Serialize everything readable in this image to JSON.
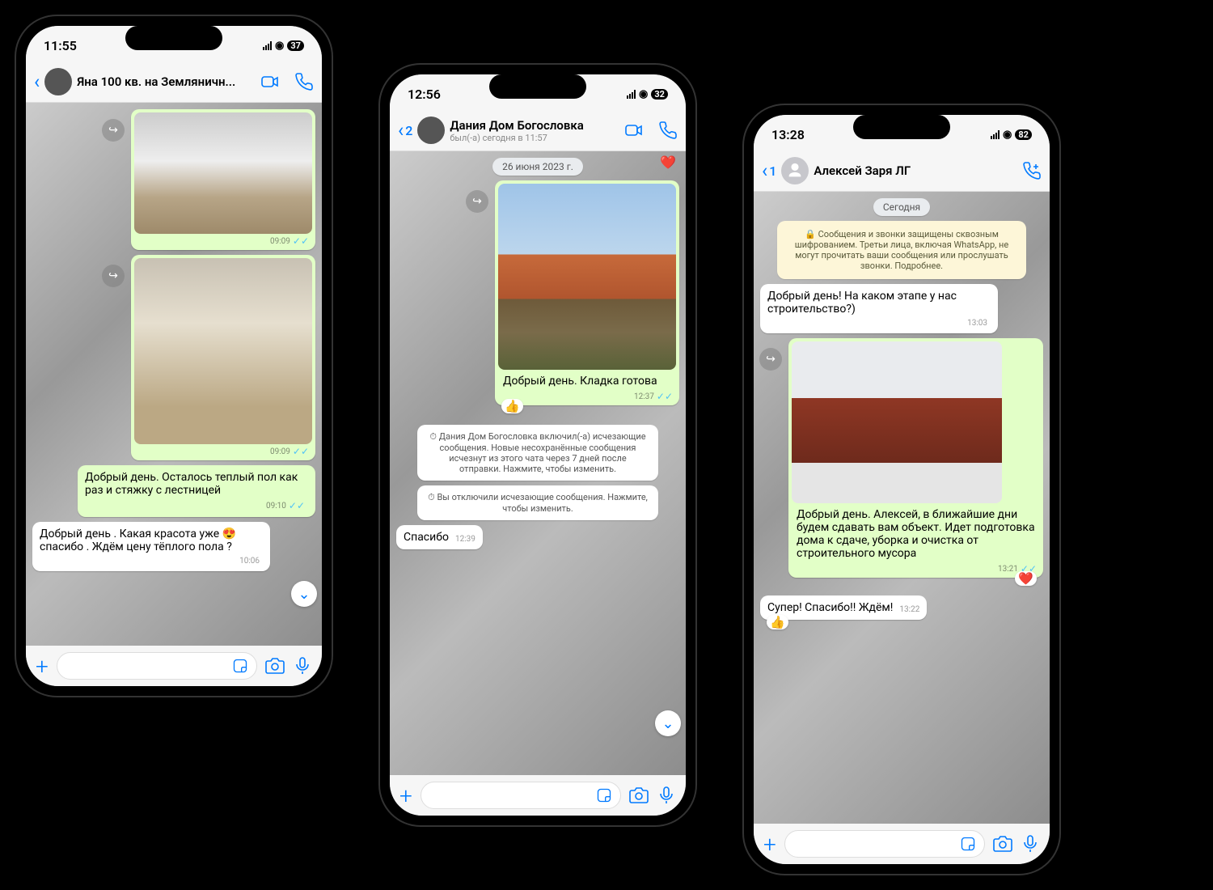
{
  "phone1": {
    "status_time": "11:55",
    "battery": "37",
    "contact": "Яна 100 кв. на Земляничн...",
    "img1_time": "09:09",
    "img2_time": "09:09",
    "out_msg": "Добрый день. Осталось теплый пол как раз и стяжку с лестницей",
    "out_time": "09:10",
    "in_msg": "Добрый день . Какая красота уже 😍 спасибо . Ждём цену тёплого пола ?",
    "in_time": "10:06"
  },
  "phone2": {
    "status_time": "12:56",
    "battery": "32",
    "back_count": "2",
    "contact": "Дания Дом Богословка",
    "contact_sub": "был(-а) сегодня в 11:57",
    "day": "26 июня 2023 г.",
    "out_msg": "Добрый день. Кладка готова",
    "out_time": "12:37",
    "reaction": "👍",
    "sys1": "⏱ Дания Дом Богословка включил(-а) исчезающие сообщения. Новые несохранённые сообщения исчезнут из этого чата через 7 дней после отправки. Нажмите, чтобы изменить.",
    "sys2": "⏱ Вы отключили исчезающие сообщения. Нажмите, чтобы изменить.",
    "in_msg": "Спасибо",
    "in_time": "12:39"
  },
  "phone3": {
    "status_time": "13:28",
    "battery": "82",
    "back_count": "1",
    "contact": "Алексей Заря ЛГ",
    "day": "Сегодня",
    "enc": "🔒 Сообщения и звонки защищены сквозным шифрованием. Третьи лица, включая WhatsApp, не могут прочитать ваши сообщения или прослушать звонки. Подробнее.",
    "in1": "Добрый день! На каком этапе у нас строительство?)",
    "in1_time": "13:03",
    "out_msg": "Добрый день. Алексей, в ближайшие дни будем сдавать вам объект. Идет подготовка дома к сдаче, уборка и очистка от строительного мусора",
    "out_time": "13:21",
    "out_reaction": "❤️",
    "in2": "Супер! Спасибо!! Ждём!",
    "in2_time": "13:22",
    "in2_reaction": "👍"
  }
}
